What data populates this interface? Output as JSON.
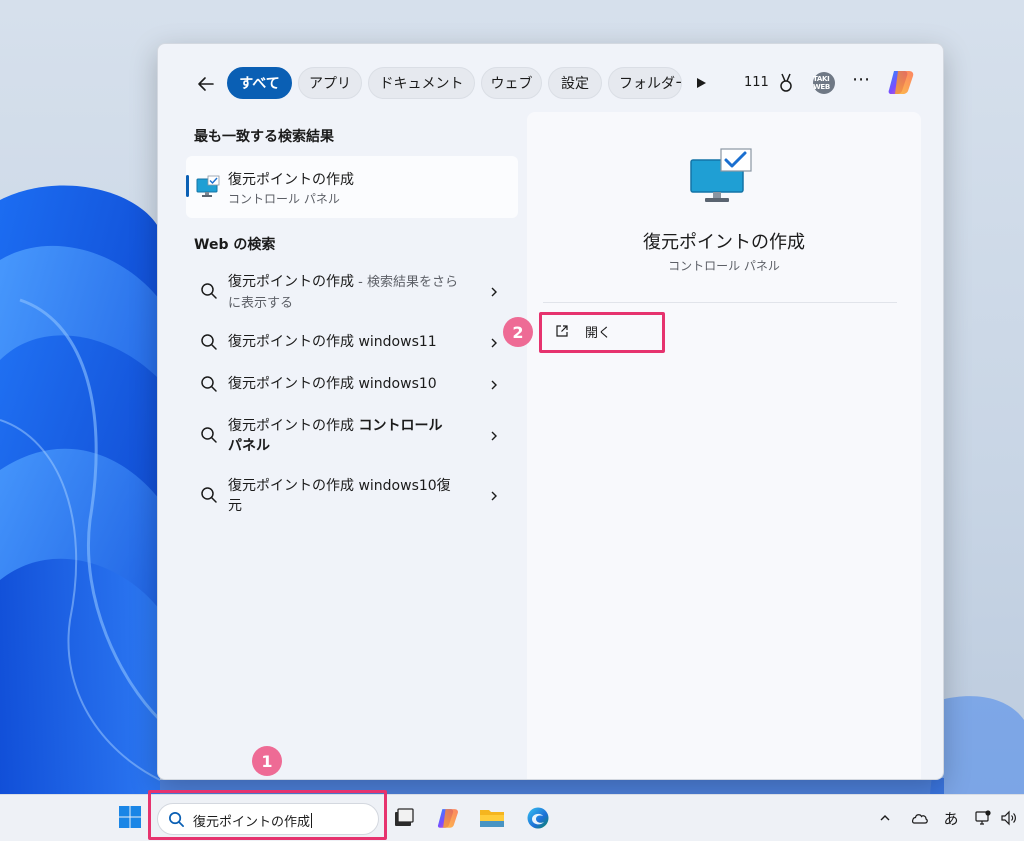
{
  "filters": {
    "items": [
      {
        "label": "すべて",
        "active": true
      },
      {
        "label": "アプリ",
        "active": false
      },
      {
        "label": "ドキュメント",
        "active": false
      },
      {
        "label": "ウェブ",
        "active": false
      },
      {
        "label": "設定",
        "active": false
      },
      {
        "label": "フォルダー",
        "active": false
      }
    ],
    "points": "111",
    "avatar_text": "TAKI WEB"
  },
  "best_match": {
    "section_title": "最も一致する検索結果",
    "title": "復元ポイントの作成",
    "subtitle": "コントロール パネル"
  },
  "web": {
    "section_title": "Web の検索",
    "results": [
      {
        "main": "復元ポイントの作成",
        "muted": " - 検索結果をさらに表示する",
        "bold": ""
      },
      {
        "main": "復元ポイントの作成 windows11",
        "muted": "",
        "bold": ""
      },
      {
        "main": "復元ポイントの作成 windows10",
        "muted": "",
        "bold": ""
      },
      {
        "main": "復元ポイントの作成 ",
        "muted": "",
        "bold": "コントロール パネル"
      },
      {
        "main": "復元ポイントの作成 windows10復元",
        "muted": "",
        "bold": ""
      }
    ]
  },
  "detail": {
    "title": "復元ポイントの作成",
    "subtitle": "コントロール パネル",
    "open_label": "開く"
  },
  "annotations": {
    "step1": "1",
    "step2": "2",
    "highlight_color": "#e6336e",
    "badge_color": "#ee6b95"
  },
  "taskbar": {
    "search_value": "復元ポイントの作成",
    "ime_label": "あ"
  },
  "colors": {
    "accent": "#0a5fb4"
  }
}
